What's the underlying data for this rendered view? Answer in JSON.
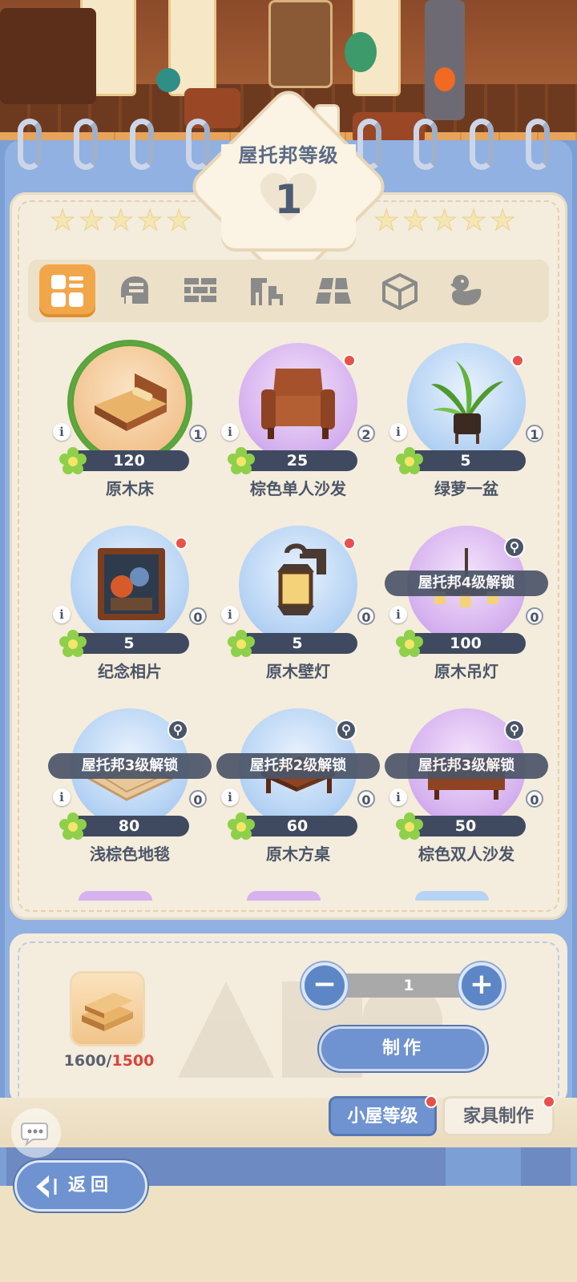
{
  "header": {
    "level_title": "屋托邦等级",
    "level_value": "1"
  },
  "tabs": [
    {
      "icon": "all-grid-icon",
      "active": true
    },
    {
      "icon": "room-shell-icon",
      "active": false
    },
    {
      "icon": "brick-wall-icon",
      "active": false
    },
    {
      "icon": "furniture-set-icon",
      "active": false
    },
    {
      "icon": "floor-tile-icon",
      "active": false
    },
    {
      "icon": "cube-icon",
      "active": false
    },
    {
      "icon": "rubber-duck-icon",
      "active": false
    }
  ],
  "items": [
    {
      "name": "原木床",
      "cost": "120",
      "owned": "1",
      "bg": "orange",
      "selected": true,
      "new": false,
      "unlock": ""
    },
    {
      "name": "棕色单人沙发",
      "cost": "25",
      "owned": "2",
      "bg": "purple",
      "selected": false,
      "new": true,
      "unlock": ""
    },
    {
      "name": "绿萝一盆",
      "cost": "5",
      "owned": "1",
      "bg": "blue",
      "selected": false,
      "new": true,
      "unlock": ""
    },
    {
      "name": "纪念相片",
      "cost": "5",
      "owned": "0",
      "bg": "blue",
      "selected": false,
      "new": true,
      "unlock": ""
    },
    {
      "name": "原木壁灯",
      "cost": "5",
      "owned": "0",
      "bg": "blue",
      "selected": false,
      "new": true,
      "unlock": ""
    },
    {
      "name": "原木吊灯",
      "cost": "100",
      "owned": "0",
      "bg": "purple",
      "selected": false,
      "new": false,
      "unlock": "屋托邦4级解锁"
    },
    {
      "name": "浅棕色地毯",
      "cost": "80",
      "owned": "0",
      "bg": "blue",
      "selected": false,
      "new": false,
      "unlock": "屋托邦3级解锁"
    },
    {
      "name": "原木方桌",
      "cost": "60",
      "owned": "0",
      "bg": "blue",
      "selected": false,
      "new": false,
      "unlock": "屋托邦2级解锁"
    },
    {
      "name": "棕色双人沙发",
      "cost": "50",
      "owned": "0",
      "bg": "purple",
      "selected": false,
      "new": false,
      "unlock": "屋托邦3级解锁"
    }
  ],
  "craft": {
    "material_have": "1600",
    "material_sep": "/",
    "material_need": "1500",
    "quantity": "1",
    "minus": "−",
    "plus": "+",
    "craft_label": "制作"
  },
  "bottom_tabs": {
    "level": "小屋等级",
    "furniture": "家具制作"
  },
  "back_label": "返回",
  "colors": {
    "accent_blue": "#6f93d0",
    "active_tab_orange": "#f2a64a",
    "alert_red": "#e8514a",
    "insufficient_red": "#d8443c"
  }
}
